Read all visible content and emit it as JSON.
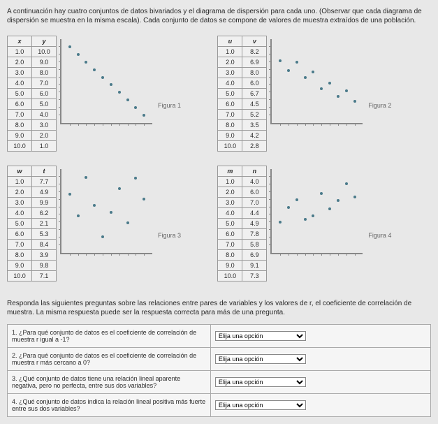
{
  "intro": "A continuación hay cuatro conjuntos de datos bivariados y el diagrama de dispersión para cada uno. (Observar que cada diagrama de dispersión se muestra en la misma escala). Cada conjunto de datos se compone de valores de muestra extraídos de una población.",
  "fig1": {
    "h1": "x",
    "h2": "y",
    "rows": [
      [
        "1.0",
        "10.0"
      ],
      [
        "2.0",
        "9.0"
      ],
      [
        "3.0",
        "8.0"
      ],
      [
        "4.0",
        "7.0"
      ],
      [
        "5.0",
        "6.0"
      ],
      [
        "6.0",
        "5.0"
      ],
      [
        "7.0",
        "4.0"
      ],
      [
        "8.0",
        "3.0"
      ],
      [
        "9.0",
        "2.0"
      ],
      [
        "10.0",
        "1.0"
      ]
    ],
    "label": "Figura 1"
  },
  "fig2": {
    "h1": "u",
    "h2": "v",
    "rows": [
      [
        "1.0",
        "8.2"
      ],
      [
        "2.0",
        "6.9"
      ],
      [
        "3.0",
        "8.0"
      ],
      [
        "4.0",
        "6.0"
      ],
      [
        "5.0",
        "6.7"
      ],
      [
        "6.0",
        "4.5"
      ],
      [
        "7.0",
        "5.2"
      ],
      [
        "8.0",
        "3.5"
      ],
      [
        "9.0",
        "4.2"
      ],
      [
        "10.0",
        "2.8"
      ]
    ],
    "label": "Figura 2"
  },
  "fig3": {
    "h1": "w",
    "h2": "t",
    "rows": [
      [
        "1.0",
        "7.7"
      ],
      [
        "2.0",
        "4.9"
      ],
      [
        "3.0",
        "9.9"
      ],
      [
        "4.0",
        "6.2"
      ],
      [
        "5.0",
        "2.1"
      ],
      [
        "6.0",
        "5.3"
      ],
      [
        "7.0",
        "8.4"
      ],
      [
        "8.0",
        "3.9"
      ],
      [
        "9.0",
        "9.8"
      ],
      [
        "10.0",
        "7.1"
      ]
    ],
    "label": "Figura 3"
  },
  "fig4": {
    "h1": "m",
    "h2": "n",
    "rows": [
      [
        "1.0",
        "4.0"
      ],
      [
        "2.0",
        "6.0"
      ],
      [
        "3.0",
        "7.0"
      ],
      [
        "4.0",
        "4.4"
      ],
      [
        "5.0",
        "4.9"
      ],
      [
        "6.0",
        "7.8"
      ],
      [
        "7.0",
        "5.8"
      ],
      [
        "8.0",
        "6.9"
      ],
      [
        "9.0",
        "9.1"
      ],
      [
        "10.0",
        "7.3"
      ]
    ],
    "label": "Figura 4"
  },
  "qintro": "Responda las siguientes preguntas sobre las relaciones entre pares de variables y los valores de r, el coeficiente de correlación de muestra. La misma respuesta puede ser la respuesta correcta para más de una pregunta.",
  "q1": "1. ¿Para qué conjunto de datos es el coeficiente de correlación de muestra r igual a -1?",
  "q2": "2. ¿Para qué conjunto de datos es el coeficiente de correlación de muestra r más cercano a 0?",
  "q3": "3. ¿Qué conjunto de datos tiene una relación lineal aparente negativa, pero no perfecta, entre sus dos variables?",
  "q4": "4. ¿Qué conjunto de datos indica la relación lineal positiva más fuerte entre sus dos variables?",
  "opt": "Elija una opción",
  "chart_data": [
    {
      "type": "scatter",
      "title": "Figura 1",
      "x": [
        1,
        2,
        3,
        4,
        5,
        6,
        7,
        8,
        9,
        10
      ],
      "y": [
        10,
        9,
        8,
        7,
        6,
        5,
        4,
        3,
        2,
        1
      ],
      "xlim": [
        0,
        11
      ],
      "ylim": [
        0,
        11
      ]
    },
    {
      "type": "scatter",
      "title": "Figura 2",
      "x": [
        1,
        2,
        3,
        4,
        5,
        6,
        7,
        8,
        9,
        10
      ],
      "y": [
        8.2,
        6.9,
        8.0,
        6.0,
        6.7,
        4.5,
        5.2,
        3.5,
        4.2,
        2.8
      ],
      "xlim": [
        0,
        11
      ],
      "ylim": [
        0,
        11
      ]
    },
    {
      "type": "scatter",
      "title": "Figura 3",
      "x": [
        1,
        2,
        3,
        4,
        5,
        6,
        7,
        8,
        9,
        10
      ],
      "y": [
        7.7,
        4.9,
        9.9,
        6.2,
        2.1,
        5.3,
        8.4,
        3.9,
        9.8,
        7.1
      ],
      "xlim": [
        0,
        11
      ],
      "ylim": [
        0,
        11
      ]
    },
    {
      "type": "scatter",
      "title": "Figura 4",
      "x": [
        1,
        2,
        3,
        4,
        5,
        6,
        7,
        8,
        9,
        10
      ],
      "y": [
        4.0,
        6.0,
        7.0,
        4.4,
        4.9,
        7.8,
        5.8,
        6.9,
        9.1,
        7.3
      ],
      "xlim": [
        0,
        11
      ],
      "ylim": [
        0,
        11
      ]
    }
  ]
}
